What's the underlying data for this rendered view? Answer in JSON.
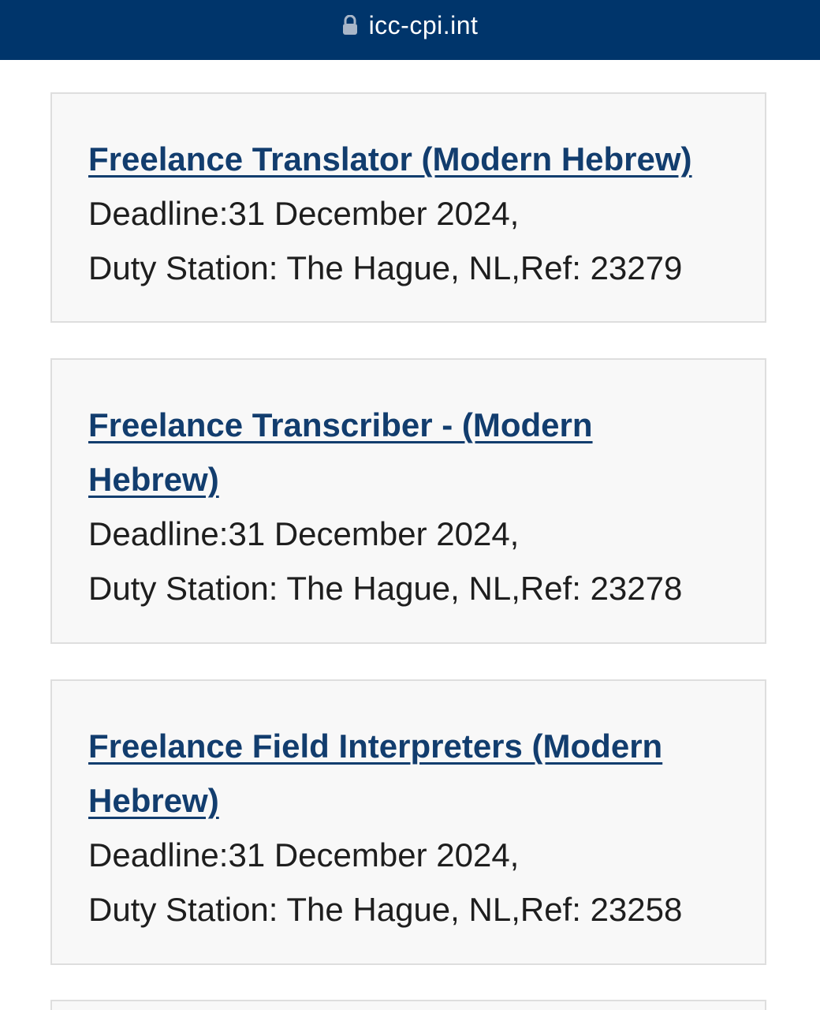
{
  "browser": {
    "url": "icc-cpi.int",
    "lock_icon": "lock-icon"
  },
  "colors": {
    "top_bar": "#00356b",
    "link": "#123d6e",
    "card_bg": "#f8f8f8",
    "card_border": "#dedede",
    "text": "#1e1e1e"
  },
  "jobs": [
    {
      "title_lines": [
        "Freelance Translator (Modern Hebrew)"
      ],
      "deadline": "Deadline:31 December 2024,",
      "station": "Duty Station: The Hague, NL,Ref: 23279"
    },
    {
      "title_lines": [
        "Freelance Transcriber - (Modern",
        "Hebrew)"
      ],
      "deadline": "Deadline:31 December 2024,",
      "station": "Duty Station: The Hague, NL,Ref: 23278"
    },
    {
      "title_lines": [
        "Freelance Field Interpreters (Modern",
        "Hebrew)"
      ],
      "deadline": "Deadline:31 December 2024,",
      "station": "Duty Station: The Hague, NL,Ref: 23258"
    }
  ]
}
